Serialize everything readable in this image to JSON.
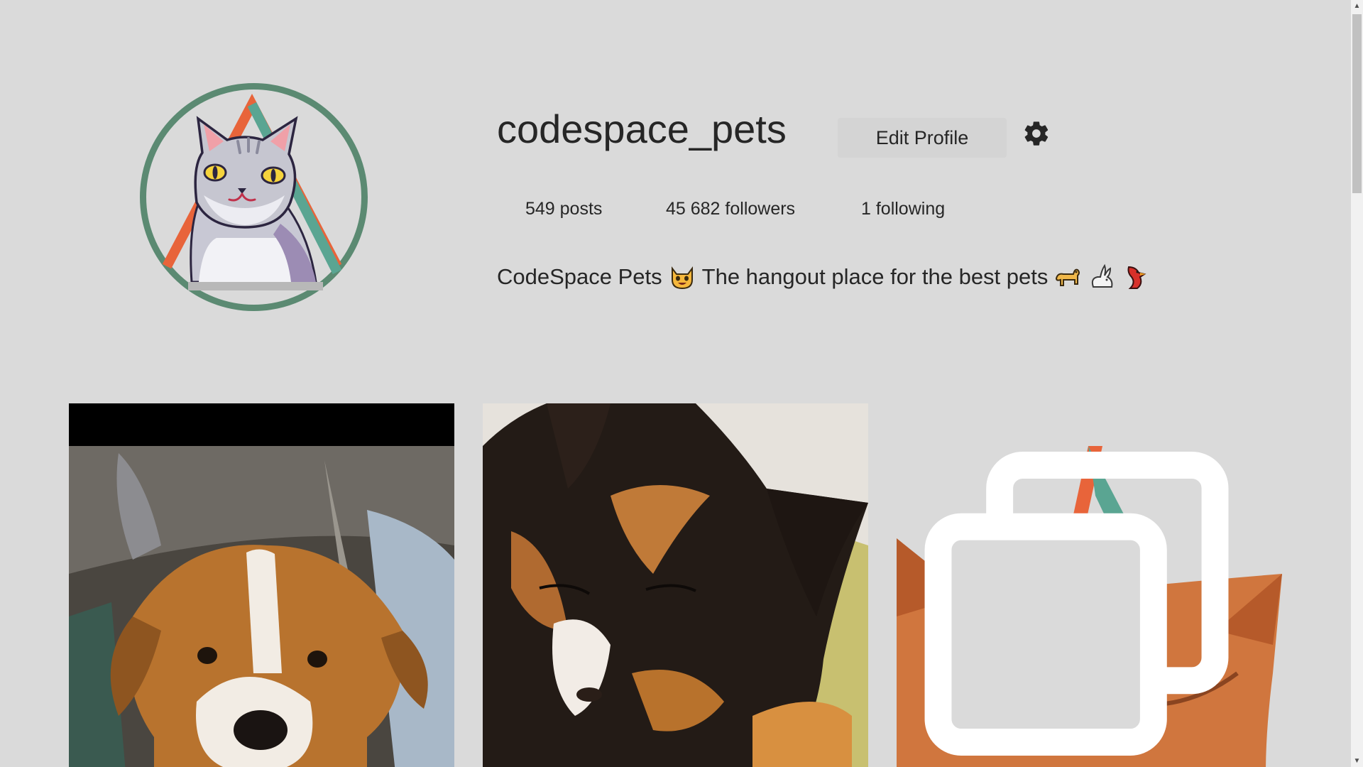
{
  "profile": {
    "username": "codespace_pets",
    "edit_label": "Edit Profile",
    "settings_icon": "gear-icon",
    "avatar_icon": "cat-logo-avatar",
    "stats": {
      "posts": "549 posts",
      "followers": "45 682 followers",
      "following": "1 following"
    },
    "bio": {
      "name": "CodeSpace Pets",
      "text": "The hangout place for the best pets",
      "emojis": [
        "cat-face-icon",
        "dog-icon",
        "rabbit-icon",
        "bird-icon"
      ]
    }
  },
  "posts": [
    {
      "subject": "dog",
      "icon": "dog-photo"
    },
    {
      "subject": "calico-cat",
      "icon": "cat-photo"
    },
    {
      "subject": "orange-cat",
      "icon": "cat-photo",
      "multi": true,
      "multi_icon": "multiple-images-icon"
    }
  ],
  "colors": {
    "background": "#dadada",
    "brand_green": "#5b8a72",
    "brand_orange": "#e8643a",
    "brand_teal": "#5aa592"
  }
}
